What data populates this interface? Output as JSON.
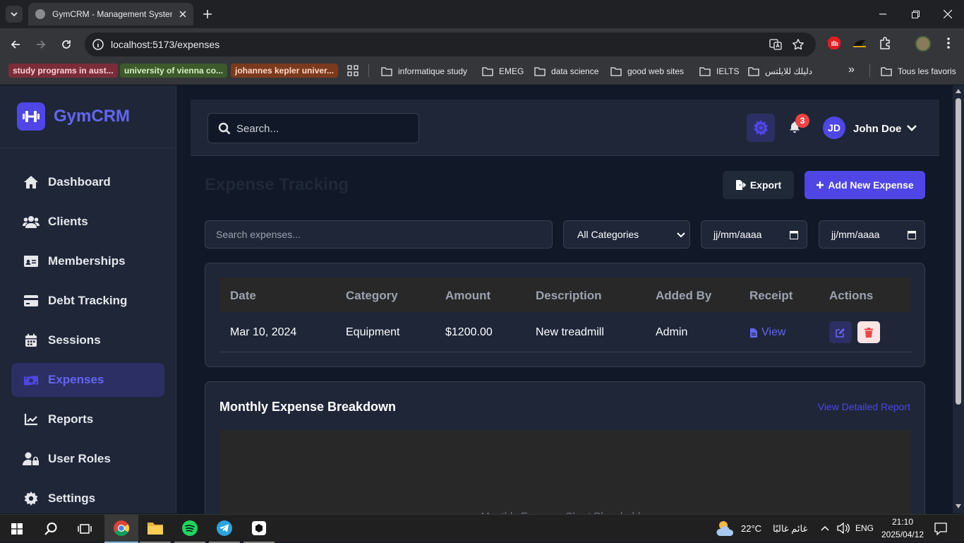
{
  "browser": {
    "tab_title": "GymCRM - Management System",
    "url": "localhost:5173/expenses",
    "bookmark_chips": [
      {
        "label": "study programs in aust...",
        "bg": "#7a2d38",
        "fg": "#ffd0d6"
      },
      {
        "label": "university of vienna co...",
        "bg": "#3c5a2c",
        "fg": "#d7f2c0"
      },
      {
        "label": "johannes kepler univer...",
        "bg": "#7a3a1e",
        "fg": "#ffd8c4"
      }
    ],
    "bookmark_folders": [
      "informatique study",
      "EMEG",
      "data science",
      "good web sites",
      "IELTS",
      "دليلك للايلتس"
    ],
    "overflow_label": "»",
    "all_bookmarks": "Tous les favoris"
  },
  "app": {
    "brand": "GymCRM",
    "accent": "#4f46e5",
    "nav": [
      {
        "label": "Dashboard",
        "icon": "home-icon"
      },
      {
        "label": "Clients",
        "icon": "users-icon"
      },
      {
        "label": "Memberships",
        "icon": "id-card-icon"
      },
      {
        "label": "Debt Tracking",
        "icon": "credit-card-icon"
      },
      {
        "label": "Sessions",
        "icon": "calendar-icon"
      },
      {
        "label": "Expenses",
        "icon": "money-bill-icon",
        "active": true
      },
      {
        "label": "Reports",
        "icon": "chart-line-icon"
      },
      {
        "label": "User Roles",
        "icon": "user-lock-icon"
      },
      {
        "label": "Settings",
        "icon": "gear-icon"
      }
    ]
  },
  "header": {
    "search_placeholder": "Search...",
    "notification_count": "3",
    "user_initials": "JD",
    "user_name": "John Doe"
  },
  "page": {
    "title": "Expense Tracking",
    "export_label": "Export",
    "add_label": "Add New Expense",
    "filters": {
      "search_placeholder": "Search expenses...",
      "category_selected": "All Categories",
      "date_from_placeholder": "jj/mm/aaaa",
      "date_to_placeholder": "jj/mm/aaaa"
    },
    "table": {
      "headers": [
        "Date",
        "Category",
        "Amount",
        "Description",
        "Added By",
        "Receipt",
        "Actions"
      ],
      "rows": [
        {
          "date": "Mar 10, 2024",
          "category": "Equipment",
          "amount": "$1200.00",
          "description": "New treadmill",
          "added_by": "Admin",
          "receipt": "View"
        }
      ]
    },
    "breakdown": {
      "title": "Monthly Expense Breakdown",
      "link": "View Detailed Report",
      "placeholder": "Monthly Expense Chart Placeholder"
    }
  },
  "taskbar": {
    "temperature": "22°C",
    "weather": "غائم غالبًا",
    "language": "ENG",
    "time": "21:10",
    "date": "2025/04/12"
  }
}
